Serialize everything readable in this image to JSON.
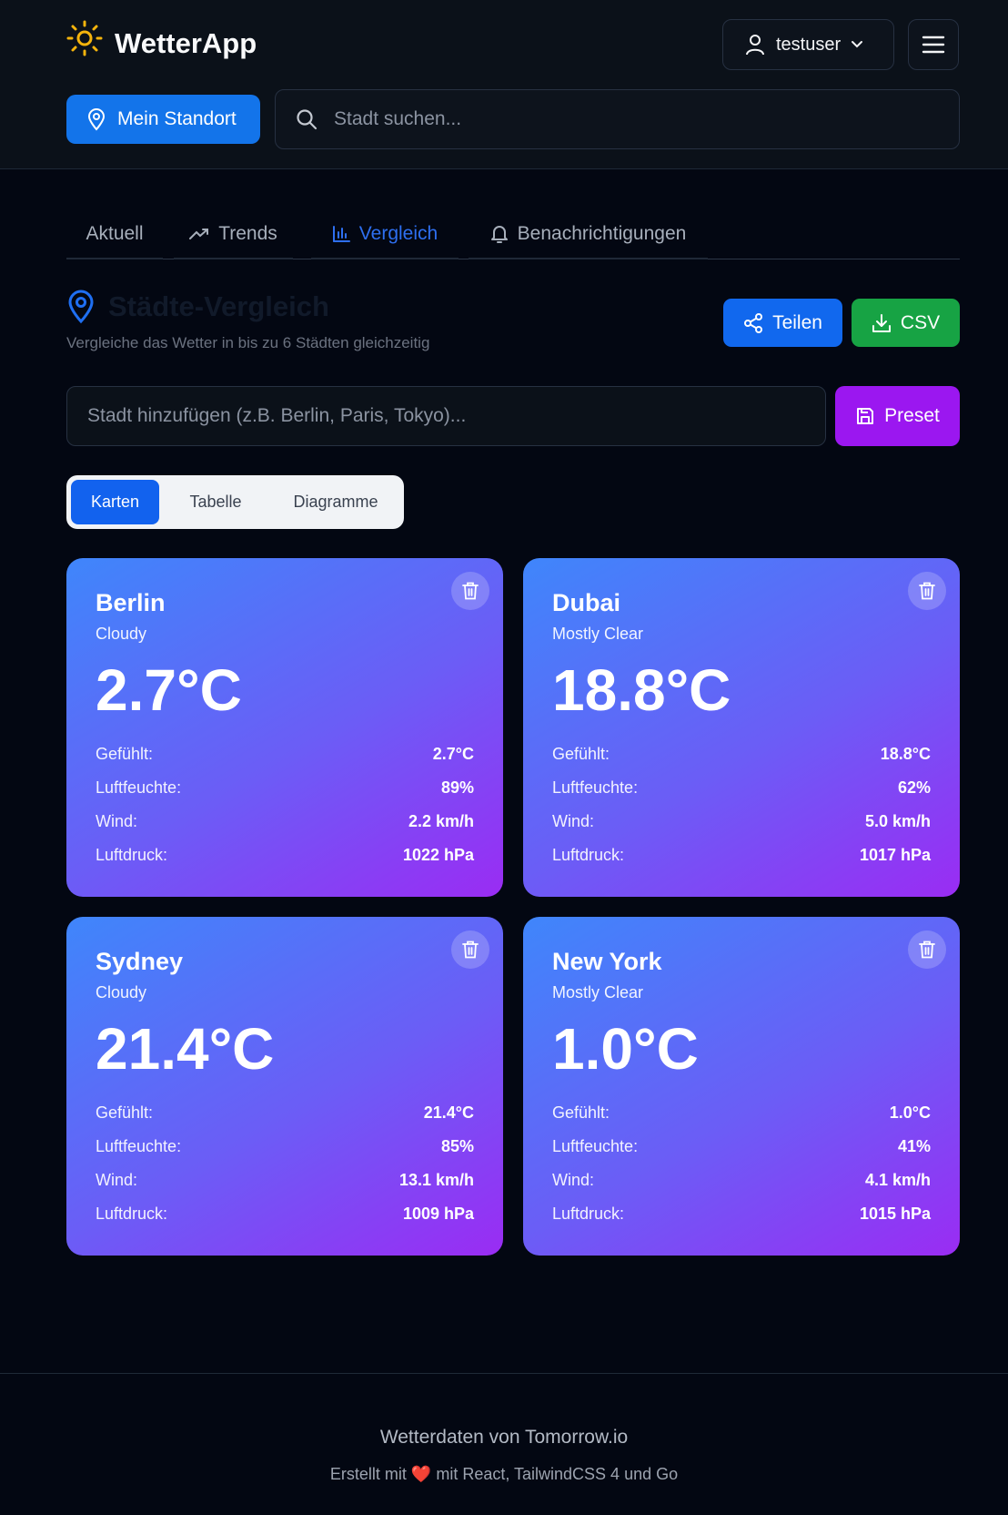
{
  "app": {
    "title": "WetterApp"
  },
  "header": {
    "user_name": "testuser",
    "location_button": "Mein Standort",
    "search_placeholder": "Stadt suchen..."
  },
  "tabs": [
    {
      "label": "Aktuell",
      "active": false
    },
    {
      "label": "Trends",
      "active": false,
      "icon": "trending-up-icon"
    },
    {
      "label": "Vergleich",
      "active": true,
      "icon": "bar-chart-icon"
    },
    {
      "label": "Benachrichtigungen",
      "active": false,
      "icon": "bell-icon"
    }
  ],
  "compare": {
    "title": "Städte-Vergleich",
    "subtitle": "Vergleiche das Wetter in bis zu 6 Städten gleichzeitig",
    "share_label": "Teilen",
    "csv_label": "CSV",
    "add_placeholder": "Stadt hinzufügen (z.B. Berlin, Paris, Tokyo)...",
    "preset_label": "Preset",
    "views": [
      {
        "label": "Karten",
        "active": true
      },
      {
        "label": "Tabelle",
        "active": false
      },
      {
        "label": "Diagramme",
        "active": false
      }
    ]
  },
  "labels": {
    "feels": "Gefühlt:",
    "humidity": "Luftfeuchte:",
    "wind": "Wind:",
    "pressure": "Luftdruck:"
  },
  "cities": [
    {
      "name": "Berlin",
      "condition": "Cloudy",
      "temp": "2.7°C",
      "feels": "2.7°C",
      "humidity": "89%",
      "wind": "2.2 km/h",
      "pressure": "1022 hPa"
    },
    {
      "name": "Dubai",
      "condition": "Mostly Clear",
      "temp": "18.8°C",
      "feels": "18.8°C",
      "humidity": "62%",
      "wind": "5.0 km/h",
      "pressure": "1017 hPa"
    },
    {
      "name": "Sydney",
      "condition": "Cloudy",
      "temp": "21.4°C",
      "feels": "21.4°C",
      "humidity": "85%",
      "wind": "13.1 km/h",
      "pressure": "1009 hPa"
    },
    {
      "name": "New York",
      "condition": "Mostly Clear",
      "temp": "1.0°C",
      "feels": "1.0°C",
      "humidity": "41%",
      "wind": "4.1 km/h",
      "pressure": "1015 hPa"
    }
  ],
  "footer": {
    "line1": "Wetterdaten von Tomorrow.io",
    "line2_prefix": "Erstellt mit",
    "line2_suffix": "mit React, TailwindCSS 4 und Go"
  },
  "colors": {
    "accent": "#1374ea",
    "success": "#17a344",
    "purple": "#9b17f0",
    "sun": "#f5b40c"
  }
}
